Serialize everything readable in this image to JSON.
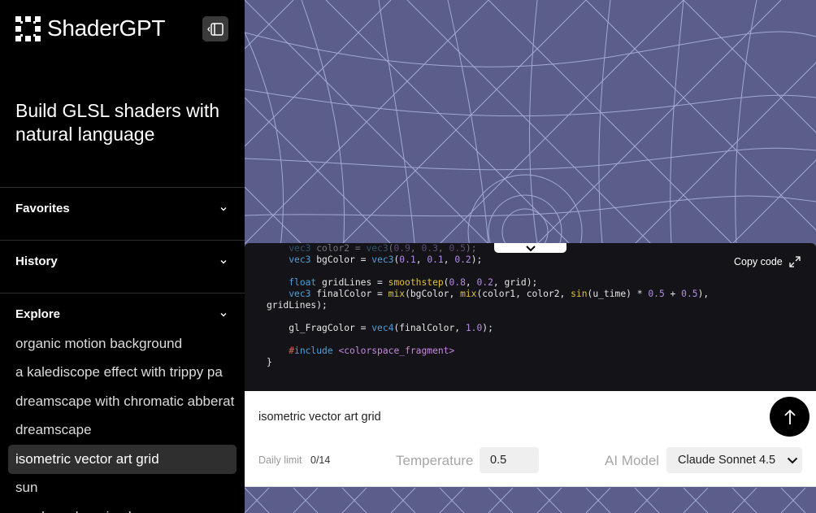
{
  "app": {
    "name": "ShaderGPT"
  },
  "sidebar": {
    "tagline": "Build GLSL shaders with natural language",
    "sections": [
      {
        "title": "Favorites"
      },
      {
        "title": "History"
      },
      {
        "title": "Explore"
      }
    ],
    "explore_items": [
      "organic motion background",
      "a kalediscope effect with trippy pa",
      "dreamscape with chromatic abberat",
      "dreamscape",
      "isometric vector art grid",
      "sun",
      "a colour changing hex"
    ],
    "active_index": 4
  },
  "code": {
    "copy_label": "Copy code",
    "lines": [
      "    vec3 color2 = vec3(0.9, 0.3, 0.5);",
      "    vec3 bgColor = vec3(0.1, 0.1, 0.2);",
      "",
      "    float gridLines = smoothstep(0.8, 0.2, grid);",
      "    vec3 finalColor = mix(bgColor, mix(color1, color2, sin(u_time) * 0.5 + 0.5),",
      "gridLines);",
      "",
      "    gl_FragColor = vec4(finalColor, 1.0);",
      "",
      "    #include <colorspace_fragment>",
      "}"
    ]
  },
  "prompt": {
    "text": "isometric vector art grid",
    "daily_limit_label": "Daily limit",
    "daily_limit_value": "0/14",
    "temperature_label": "Temperature",
    "temperature_value": "0.5",
    "model_label": "AI Model",
    "model_value": "Claude Sonnet 4.5"
  },
  "colors": {
    "canvas_bg": "#5b5d8a",
    "grid_line": "#b7c4ee",
    "code_bg": "#141418",
    "keyword": "#4f9fd8",
    "function": "#e0c23b",
    "number": "#b58ae8",
    "preprocessor": "#e0625a"
  }
}
